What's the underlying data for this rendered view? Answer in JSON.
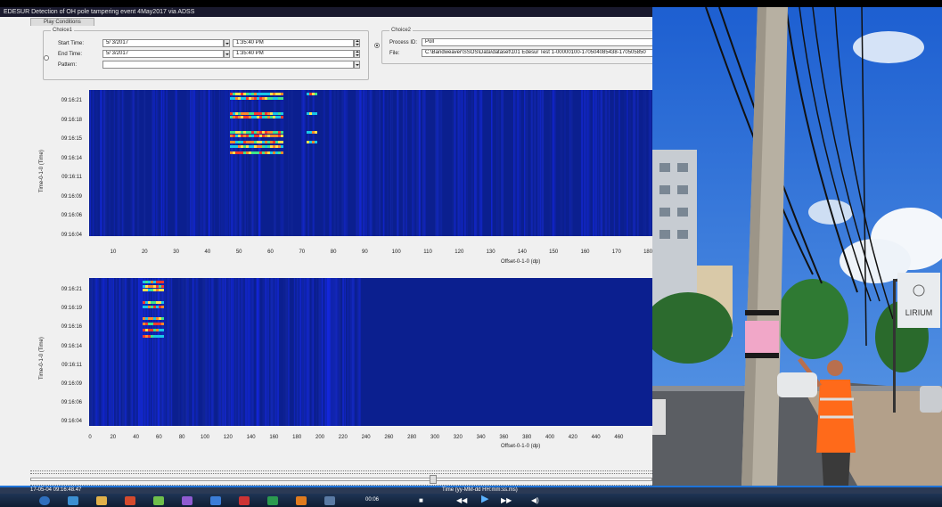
{
  "window": {
    "title": "EDESUR Detection of OH pole tampering event 4May2017 via ADSS",
    "tab": "Play Conditions"
  },
  "choice1": {
    "label": "Choice1",
    "start_time_label": "Start Time:",
    "start_date": "5/ 3/2017",
    "start_time": "1:35:40 PM",
    "end_time_label": "End Time:",
    "end_date": "5/ 3/2017",
    "end_time": "1:35:40 PM",
    "pattern_label": "Pattern:",
    "pattern_value": ""
  },
  "choice2": {
    "label": "Choice2",
    "process_id_label": "Process ID:",
    "process_id": "Poll",
    "file_label": "File:",
    "file_path": "C:\\Bandweaver\\SSOS\\Data\\dataset\\101 Edesur Test 1-00000100-170504085438-170505850"
  },
  "plot_top": {
    "ylabel": "Time-0-1-0 (Time)",
    "xlabel": "Offset-0-1-0 (dp)",
    "yticks": [
      "09:16:21",
      "09:16:18",
      "09:16:15",
      "09:16:14",
      "09:16:11",
      "09:16:09",
      "09:16:06",
      "09:16:04"
    ],
    "xticks": [
      "10",
      "20",
      "30",
      "40",
      "50",
      "60",
      "70",
      "80",
      "90",
      "100",
      "110",
      "120",
      "130",
      "140",
      "150",
      "160",
      "170",
      "180"
    ]
  },
  "plot_bottom": {
    "ylabel": "Time-0-1-0 (Time)",
    "xlabel": "Offset-0-1-0 (dp)",
    "yticks": [
      "09:16:21",
      "09:16:19",
      "09:16:16",
      "09:16:14",
      "09:16:11",
      "09:16:09",
      "09:16:06",
      "09:16:04"
    ],
    "xticks": [
      "0",
      "20",
      "40",
      "60",
      "80",
      "100",
      "120",
      "140",
      "160",
      "180",
      "200",
      "220",
      "240",
      "260",
      "280",
      "300",
      "320",
      "340",
      "360",
      "380",
      "400",
      "420",
      "440",
      "460"
    ]
  },
  "status": {
    "timestamp": "17-05-04 09:16:48.47",
    "time_format": "Time (yy-MM-dd HH:mm:ss.ms)"
  },
  "video": {
    "elapsed": "00:06",
    "sign_text": "LIRIUM"
  },
  "colors": {
    "heatmap_bg": "#0b1f8f",
    "accent_blue": "#1e73d8"
  }
}
